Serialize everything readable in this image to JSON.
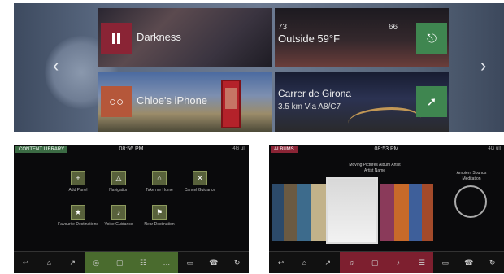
{
  "home": {
    "media_title": "Darkness",
    "climate_temp_left": "73",
    "climate_outside": "Outside 59°F",
    "climate_temp_right": "66",
    "phone_title": "Chloe's iPhone",
    "nav_destination": "Carrer de Girona",
    "nav_route": "3.5 km Via A8/C7"
  },
  "library_screen": {
    "label": "CONTENT LIBRARY",
    "clock": "08:56 PM",
    "status": "4G ull ",
    "items": [
      {
        "label": "Add Panel",
        "icon": "+"
      },
      {
        "label": "Navigation",
        "icon": "△"
      },
      {
        "label": "Take me Home",
        "icon": "⌂"
      },
      {
        "label": "Cancel Guidance",
        "icon": "✕"
      },
      {
        "label": "Favourite Destinations",
        "icon": "★"
      },
      {
        "label": "Voice Guidance",
        "icon": "♪"
      },
      {
        "label": "Near Destination",
        "icon": "⚑"
      }
    ],
    "dock": [
      "↩",
      "⌂",
      "↗",
      "◎",
      "▢",
      "☷",
      "…",
      "▭",
      "☎",
      "↻"
    ]
  },
  "media_screen": {
    "label": "ALBUMS",
    "clock": "08:53 PM",
    "status": "4G ull",
    "now_playing_line1": "Moving Pictures Album Artist",
    "now_playing_line2": "Artist Name",
    "dial_line1": "Ambient Sounds",
    "dial_line2": "Meditation",
    "dock": [
      "↩",
      "⌂",
      "↗",
      "♫",
      "▢",
      "♪",
      "☰",
      "▭",
      "☎",
      "↻"
    ]
  },
  "colors": {
    "media_accent": "#8a2435",
    "phone_accent": "#b5573a",
    "climate_accent": "#3f8650",
    "library_accent": "#4a6b2e"
  }
}
